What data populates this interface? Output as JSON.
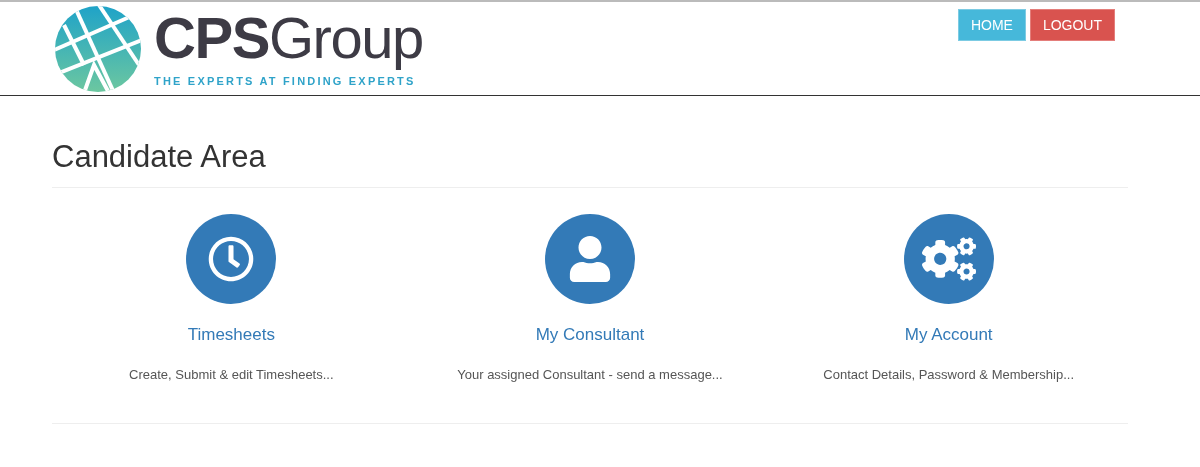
{
  "logo": {
    "brand_bold": "CPS",
    "brand_light": "Group",
    "tagline": "THE EXPERTS AT FINDING EXPERTS"
  },
  "nav_buttons": [
    {
      "label": "HOME",
      "kind": "info"
    },
    {
      "label": "LOGOUT",
      "kind": "danger"
    }
  ],
  "page_title": "Candidate Area",
  "tiles": [
    {
      "kind": "clock",
      "title": "Timesheets",
      "description": "Create, Submit & edit Timesheets..."
    },
    {
      "kind": "user",
      "title": "My Consultant",
      "description": "Your assigned Consultant - send a message..."
    },
    {
      "kind": "gears",
      "title": "My Account",
      "description": "Contact Details, Password & Membership..."
    }
  ]
}
